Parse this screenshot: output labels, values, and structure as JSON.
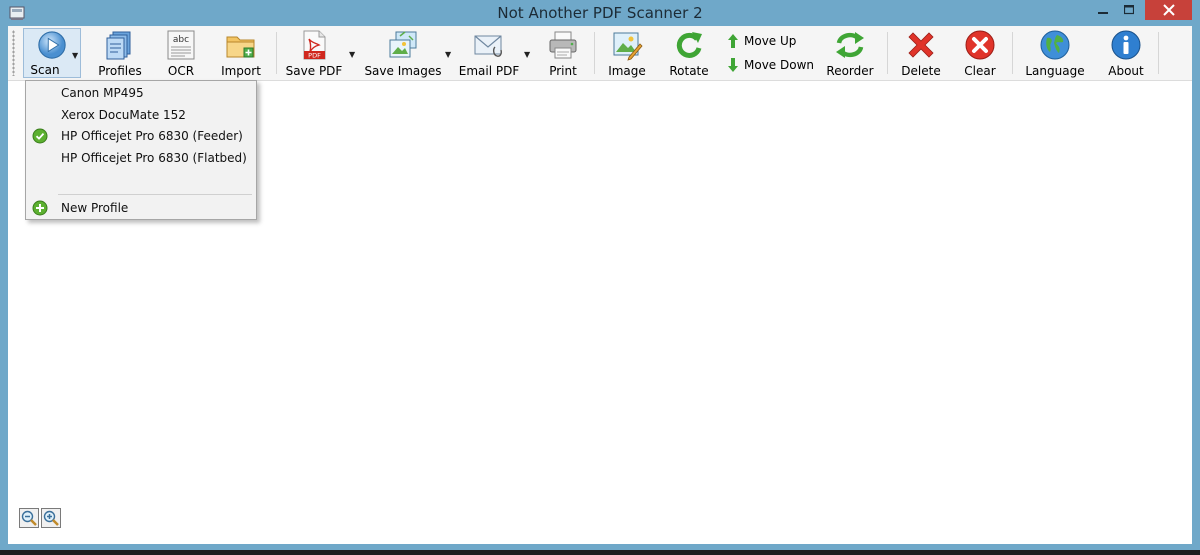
{
  "window": {
    "title": "Not Another PDF Scanner 2",
    "controls": {
      "minimize": "—",
      "maximize": "□",
      "close": "✕"
    }
  },
  "toolbar": {
    "scan": "Scan",
    "profiles": "Profiles",
    "ocr": "OCR",
    "ocr_icon_text": "abc",
    "import": "Import",
    "save_pdf": "Save PDF",
    "save_pdf_icon_text": "PDF",
    "save_images": "Save Images",
    "email_pdf": "Email PDF",
    "print": "Print",
    "image": "Image",
    "rotate": "Rotate",
    "move_up": "Move Up",
    "move_down": "Move Down",
    "reorder": "Reorder",
    "delete": "Delete",
    "clear": "Clear",
    "language": "Language",
    "about": "About"
  },
  "scan_menu": {
    "items": [
      {
        "label": "Canon MP495",
        "checked": false
      },
      {
        "label": "Xerox DocuMate 152",
        "checked": false
      },
      {
        "label": "HP Officejet Pro 6830 (Feeder)",
        "checked": true
      },
      {
        "label": "HP Officejet Pro 6830 (Flatbed)",
        "checked": false
      }
    ],
    "new_profile": "New Profile"
  },
  "icons": {
    "scan": "scan-play-icon",
    "profiles": "profiles-icon",
    "ocr": "ocr-icon",
    "import": "folder-icon",
    "save_pdf": "pdf-icon",
    "save_images": "images-icon",
    "email_pdf": "envelope-icon",
    "print": "printer-icon",
    "image": "image-edit-icon",
    "rotate": "rotate-icon",
    "move_up": "arrow-up-icon",
    "move_down": "arrow-down-icon",
    "reorder": "reorder-icon",
    "delete": "delete-x-icon",
    "clear": "clear-icon",
    "language": "globe-icon",
    "about": "info-icon",
    "check": "check-icon",
    "new_profile": "plus-icon",
    "zoom_out": "zoom-out-icon",
    "zoom_in": "zoom-in-icon"
  },
  "colors": {
    "title_bar": "#6fa8c9",
    "close_button": "#c7413a",
    "toolbar_bg": "#f5f5f5",
    "menu_bg": "#f2f2f2",
    "check_green": "#5cb030"
  }
}
